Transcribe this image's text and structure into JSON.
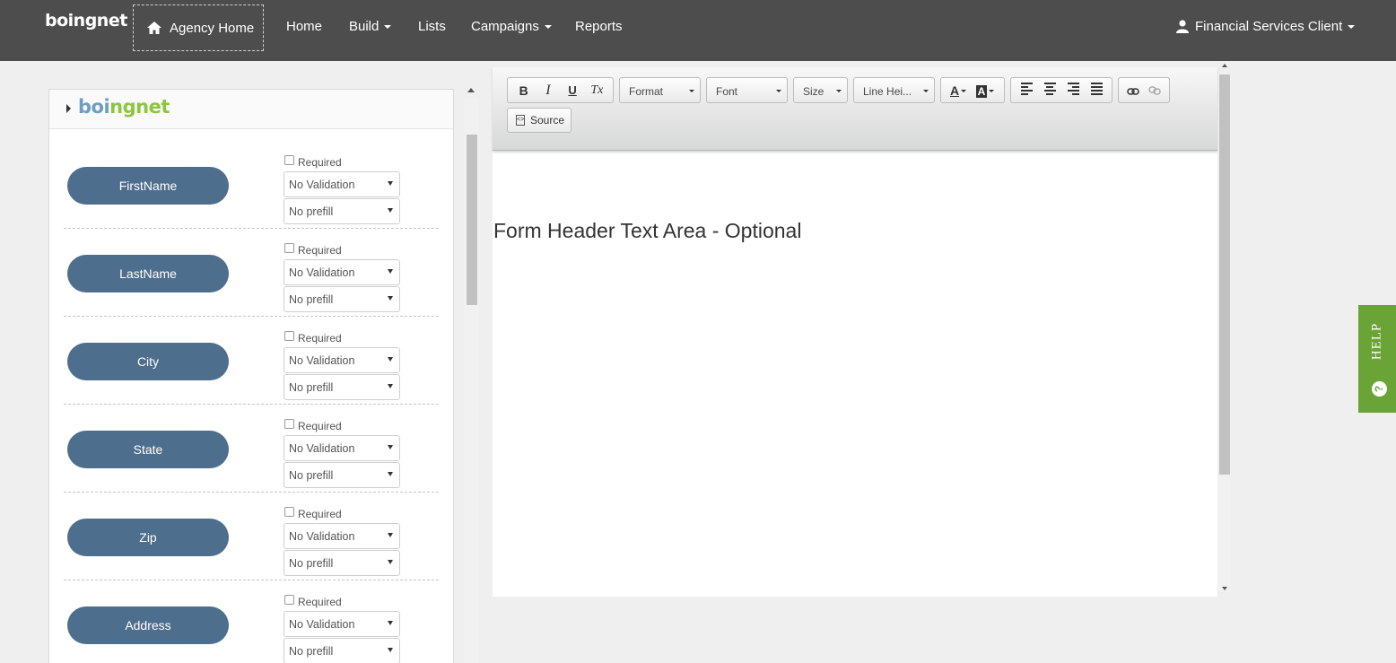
{
  "nav": {
    "brand": "boingnet",
    "agency_home": "Agency Home",
    "items": [
      {
        "label": "Home",
        "dropdown": false
      },
      {
        "label": "Build",
        "dropdown": true
      },
      {
        "label": "Lists",
        "dropdown": false
      },
      {
        "label": "Campaigns",
        "dropdown": true
      },
      {
        "label": "Reports",
        "dropdown": false
      }
    ],
    "user": "Financial Services Client",
    "icons": {
      "home": "home-icon",
      "user": "user-icon"
    }
  },
  "form_panel": {
    "logo": {
      "part1": "boi",
      "part2": "ngnet"
    },
    "required_label": "Required",
    "fields": [
      {
        "name": "FirstName",
        "validation": "No Validation",
        "prefill": "No prefill"
      },
      {
        "name": "LastName",
        "validation": "No Validation",
        "prefill": "No prefill"
      },
      {
        "name": "City",
        "validation": "No Validation",
        "prefill": "No prefill"
      },
      {
        "name": "State",
        "validation": "No Validation",
        "prefill": "No prefill"
      },
      {
        "name": "Zip",
        "validation": "No Validation",
        "prefill": "No prefill"
      },
      {
        "name": "Address",
        "validation": "No Validation",
        "prefill": "No prefill"
      }
    ]
  },
  "editor": {
    "toolbar": {
      "bold": "B",
      "italic": "I",
      "underline": "U",
      "clear_format": "Tx",
      "format": "Format",
      "font": "Font",
      "size": "Size",
      "line_height": "Line Hei...",
      "text_color": "A",
      "bg_color": "A",
      "source": "Source"
    },
    "content": "Form Header Text Area - Optional"
  },
  "help": {
    "label": "HELP",
    "icon": "?"
  },
  "colors": {
    "nav_bg": "#4d4d4d",
    "pill": "#4e6e8e",
    "help_green": "#6aa436",
    "logo_blue": "#6e9fbf",
    "logo_green": "#8cc63f"
  }
}
